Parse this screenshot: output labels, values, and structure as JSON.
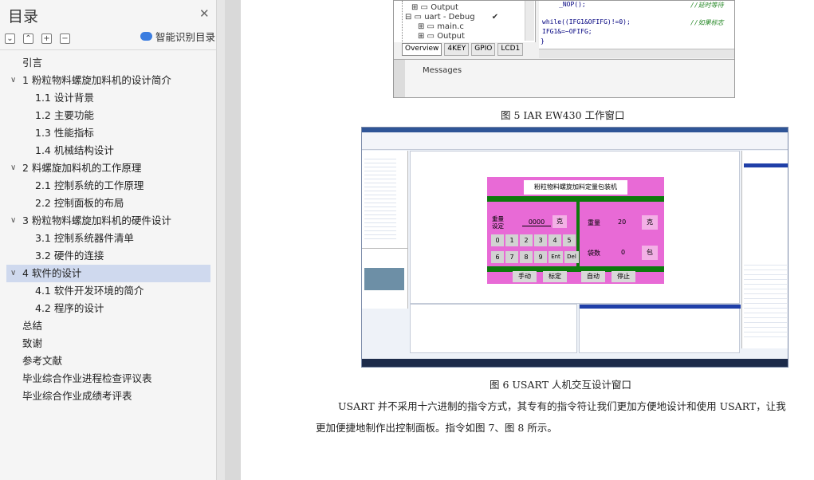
{
  "sidebar": {
    "title": "目录",
    "ai_label": "智能识别目录",
    "items": [
      {
        "label": "引言"
      },
      {
        "label": "1  粉粒物料螺旋加料机的设计简介"
      },
      {
        "label": "1.1 设计背景"
      },
      {
        "label": "1.2 主要功能"
      },
      {
        "label": "1.3  性能指标"
      },
      {
        "label": "1.4  机械结构设计"
      },
      {
        "label": "2 料螺旋加料机的工作原理"
      },
      {
        "label": "2.1  控制系统的工作原理"
      },
      {
        "label": "2.2  控制面板的布局"
      },
      {
        "label": "3 粉粒物料螺旋加料机的硬件设计"
      },
      {
        "label": "3.1 控制系统器件清单"
      },
      {
        "label": "3.2 硬件的连接"
      },
      {
        "label": "4  软件的设计"
      },
      {
        "label": "4.1 软件开发环境的简介"
      },
      {
        "label": "4.2  程序的设计"
      },
      {
        "label": "总结"
      },
      {
        "label": "致谢"
      },
      {
        "label": "参考文献"
      },
      {
        "label": "毕业综合作业进程检查评议表"
      },
      {
        "label": "毕业综合作业成绩考评表"
      }
    ]
  },
  "fig5": {
    "tree": [
      "Output",
      "uart - Debug",
      "main.c",
      "Output"
    ],
    "tabs": [
      "Overview",
      "4KEY",
      "GPIO",
      "LCD1"
    ],
    "messages_label": "Messages",
    "code": [
      "_NOP();",
      "while((IFG1&OFIFG)!=0);",
      "IFG1&=~OFIFG;",
      "}"
    ],
    "comments": [
      "//延时等待",
      "//如果标志"
    ],
    "caption": "图 5  IAR EW430 工作窗口"
  },
  "fig6": {
    "panel_title": "粉粒物料螺旋加料定量包装机",
    "weight_label": "重量\n设定",
    "weight_value": "0000",
    "unit_g": "克",
    "keys_row1": [
      "0",
      "1",
      "2",
      "3",
      "4",
      "5"
    ],
    "keys_row2": [
      "6",
      "7",
      "8",
      "9",
      "Ent",
      "Del"
    ],
    "right_weight_label": "重量",
    "right_weight_value": "20",
    "bag_label": "袋数",
    "bag_value": "0",
    "unit_bag": "包",
    "buttons": [
      "手动",
      "标定",
      "自动",
      "停止"
    ],
    "caption": "图 6  USART 人机交互设计窗口"
  },
  "body": {
    "para_line1": "USART 并不采用十六进制的指令方式，其专有的指令符让我们更加方便地设计和使用 USART，让我",
    "para_line2": "更加便捷地制作出控制面板。指令如图 7、图 8 所示。"
  }
}
